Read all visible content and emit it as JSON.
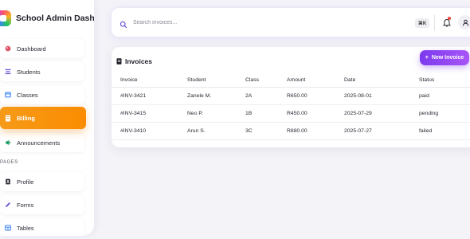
{
  "app": {
    "title": "School Admin Dash"
  },
  "sidebar": {
    "items": [
      {
        "label": "Dashboard",
        "icon": "palette-icon",
        "color": "#e0566b"
      },
      {
        "label": "Students",
        "icon": "students-icon",
        "color": "#6b5bd6"
      },
      {
        "label": "Classes",
        "icon": "classes-icon",
        "color": "#3b82f6"
      },
      {
        "label": "Billing",
        "icon": "billing-icon",
        "color": "#ffffff",
        "active": true
      },
      {
        "label": "Announcements",
        "icon": "megaphone-icon",
        "color": "#22a06b"
      }
    ],
    "section_pages": "PAGES",
    "pages": [
      {
        "label": "Profile",
        "icon": "profile-icon",
        "color": "#2a2a35"
      },
      {
        "label": "Forms",
        "icon": "pencil-icon",
        "color": "#6b5bd6"
      },
      {
        "label": "Tables",
        "icon": "table-icon",
        "color": "#3b82f6"
      }
    ]
  },
  "topbar": {
    "search_placeholder": "Search invoices...",
    "shortcut": "⌘K"
  },
  "invoices": {
    "title": "Invoices",
    "new_button": "New Invoice",
    "columns": [
      "Invoice",
      "Student",
      "Class",
      "Amount",
      "Date",
      "Status"
    ],
    "rows": [
      [
        "#INV-3421",
        "Zanele M.",
        "2A",
        "R650.00",
        "2025-08-01",
        "paid"
      ],
      [
        "#INV-3415",
        "Neo P.",
        "1B",
        "R450.00",
        "2025-07-29",
        "pending"
      ],
      [
        "#INV-3410",
        "Arun S.",
        "3C",
        "R880.00",
        "2025-07-27",
        "failed"
      ]
    ]
  },
  "colors": {
    "accent_orange": "#f59a18",
    "accent_purple": "#7c3aed",
    "notification_dot": "#f04438"
  }
}
